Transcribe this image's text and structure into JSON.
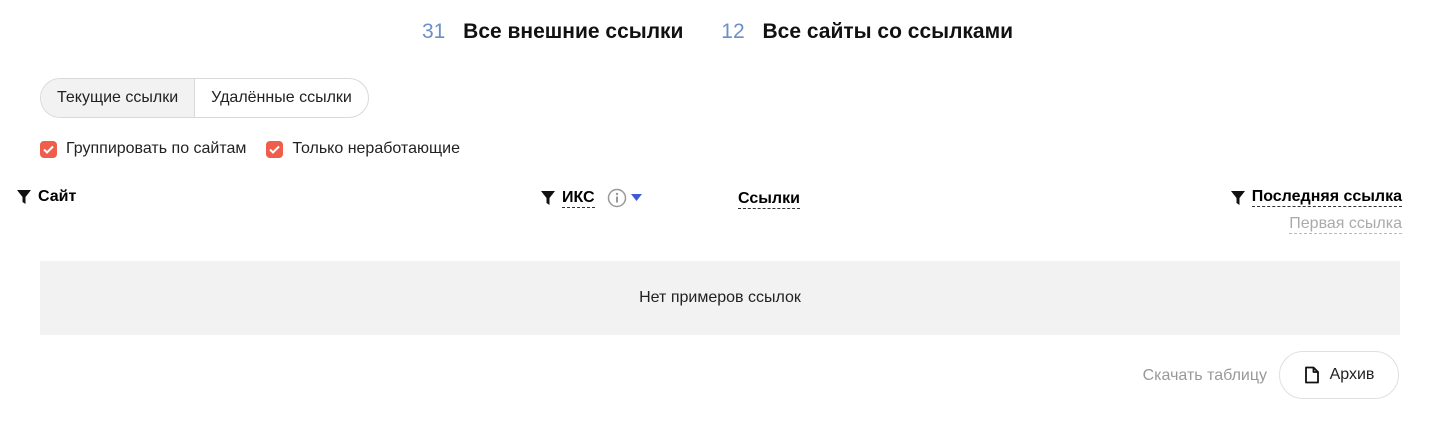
{
  "stats": [
    {
      "count": "31",
      "label": "Все внешние ссылки"
    },
    {
      "count": "12",
      "label": "Все сайты со ссылками"
    }
  ],
  "segments": {
    "current": "Текущие ссылки",
    "deleted": "Удалённые ссылки",
    "active": "current"
  },
  "filters": {
    "group_by_sites": {
      "label": "Группировать по сайтам",
      "checked": true
    },
    "only_broken": {
      "label": "Только неработающие",
      "checked": true
    }
  },
  "table": {
    "columns": {
      "site": "Сайт",
      "iks": "ИКС",
      "links": "Ссылки",
      "last_link": "Последняя ссылка",
      "first_link": "Первая ссылка"
    },
    "empty_text": "Нет примеров ссылок"
  },
  "footer": {
    "download": "Скачать таблицу",
    "archive": "Архив"
  },
  "colors": {
    "accent_red": "#ee5e4b",
    "count_blue": "#6b90c8",
    "sort_blue": "#3b5bdb"
  }
}
